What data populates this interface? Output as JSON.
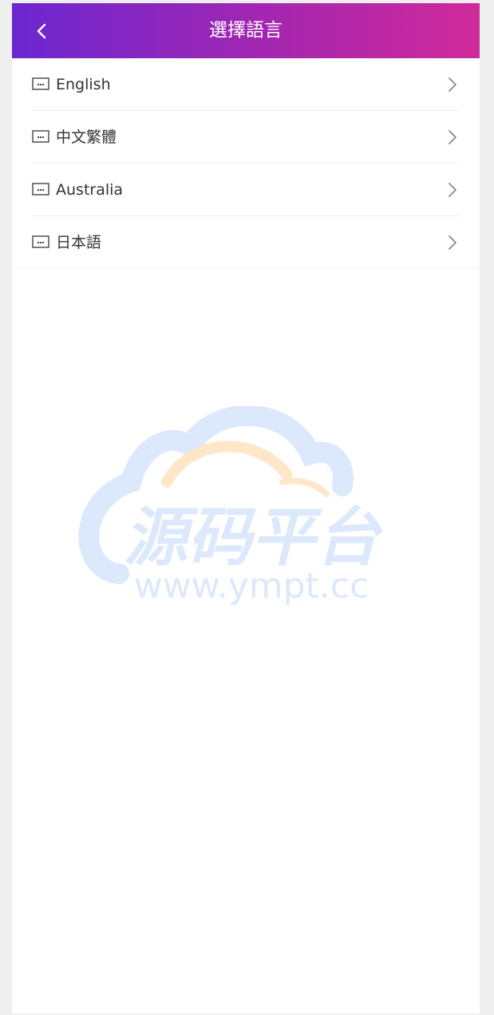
{
  "header": {
    "title": "選擇語言",
    "back_icon": "chevron-left-icon"
  },
  "languages": [
    {
      "label": "English",
      "icon": "keyboard-icon",
      "arrow_icon": "chevron-right-icon"
    },
    {
      "label": "中文繁體",
      "icon": "keyboard-icon",
      "arrow_icon": "chevron-right-icon"
    },
    {
      "label": "Australia",
      "icon": "keyboard-icon",
      "arrow_icon": "chevron-right-icon"
    },
    {
      "label": "日本語",
      "icon": "keyboard-icon",
      "arrow_icon": "chevron-right-icon"
    }
  ],
  "watermark": {
    "brand": "源码平台",
    "url": "www.ympt.cc"
  },
  "colors": {
    "header_gradient_start": "#6b27d1",
    "header_gradient_end": "#d02a9a",
    "page_background": "#efefef",
    "text": "#333333",
    "watermark_blue": "#dce8fb",
    "watermark_orange": "#fde7c8"
  }
}
